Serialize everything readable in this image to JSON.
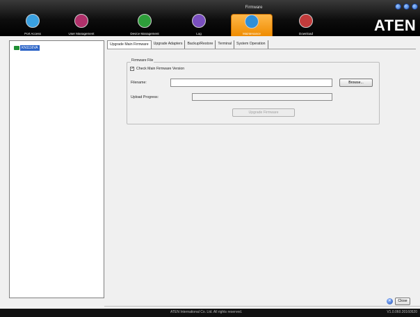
{
  "window": {
    "title": "Firmware"
  },
  "nav": [
    {
      "label": "Port Access",
      "icon": "port-access-icon",
      "color": "#3aa0e0"
    },
    {
      "label": "User Management",
      "icon": "user-management-icon",
      "color": "#b0306a"
    },
    {
      "label": "Device Management",
      "icon": "device-management-icon",
      "color": "#2e9e3a"
    },
    {
      "label": "Log",
      "icon": "log-icon",
      "color": "#7a4fbf"
    },
    {
      "label": "Maintenance",
      "icon": "maintenance-icon",
      "color": "#2f8fd8"
    },
    {
      "label": "Download",
      "icon": "download-icon",
      "color": "#c23b3b"
    }
  ],
  "brand": {
    "logo": "ATEN"
  },
  "tree": {
    "items": [
      {
        "label": "KN1116VA"
      }
    ]
  },
  "tabs": [
    {
      "label": "Upgrade Main Firmware",
      "active": true
    },
    {
      "label": "Upgrade Adapters",
      "active": false
    },
    {
      "label": "Backup/Restore",
      "active": false
    },
    {
      "label": "Terminal",
      "active": false
    },
    {
      "label": "System Operation",
      "active": false
    }
  ],
  "firmware": {
    "group_title": "Firmware File",
    "check_label": "Check Main Firmware Version",
    "checked_mark": "✓",
    "filename_label": "Filename:",
    "filename_value": "",
    "browse_label": "Browse...",
    "progress_label": "Upload Progress:",
    "progress_value": 0,
    "upgrade_label": "Upgrade Firmware"
  },
  "footer": {
    "close_label": "Close",
    "close_glyph": "✕",
    "copyright": "ATEN International Co. Ltd. All rights reserved.",
    "version": "V1.0.060.20160520"
  },
  "colors": {
    "accent": "#f39a1a",
    "selection": "#2d65c7",
    "statusbar": "#111111"
  }
}
